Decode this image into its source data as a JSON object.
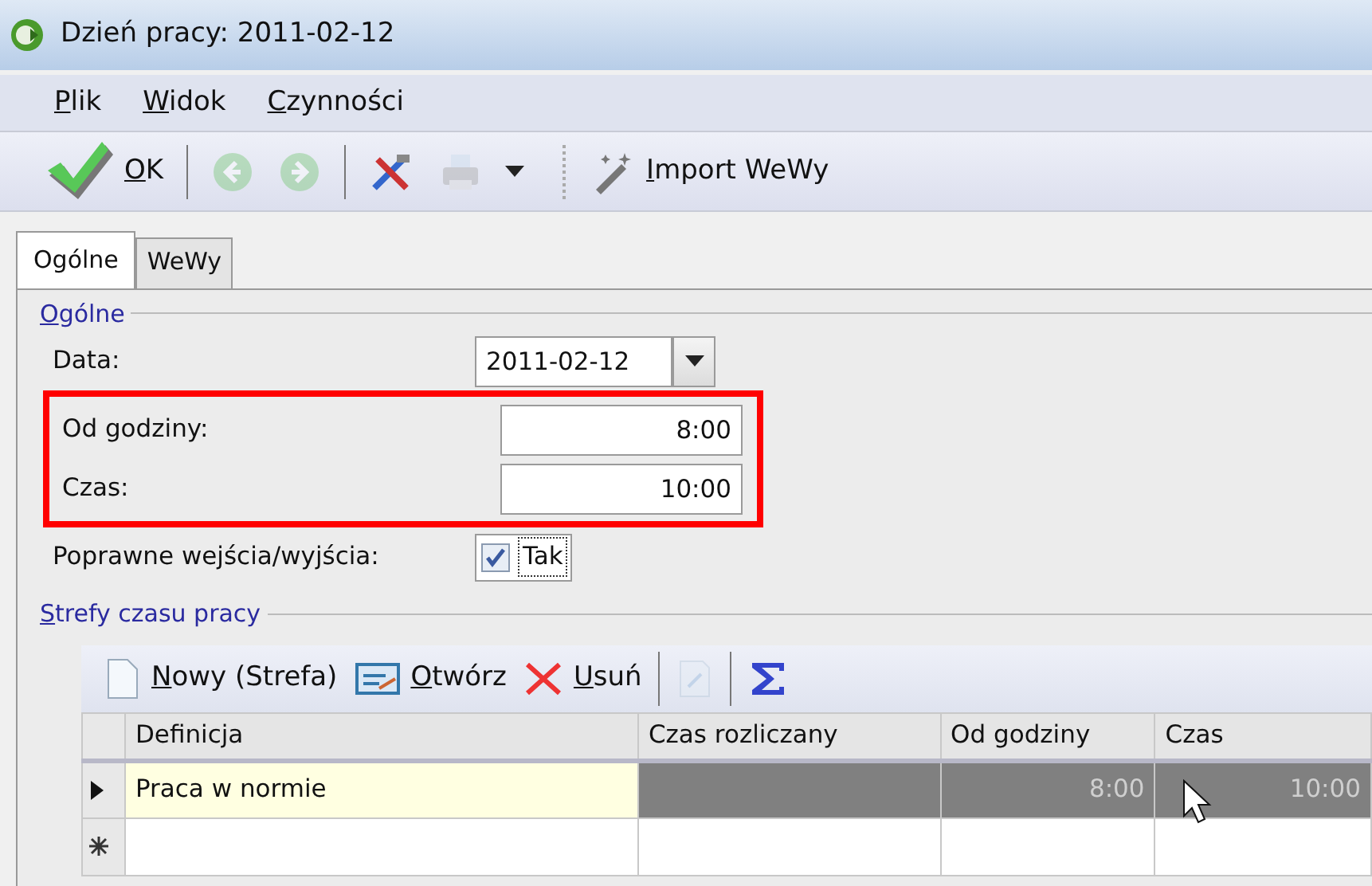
{
  "window": {
    "title": "Dzień pracy: 2011-02-12"
  },
  "menu": [
    {
      "label": "Plik"
    },
    {
      "label": "Widok"
    },
    {
      "label": "Czynności"
    }
  ],
  "toolbar": [
    {
      "kind": "ok",
      "label": "OK",
      "disabled": false
    },
    {
      "kind": "sep"
    },
    {
      "kind": "back",
      "disabled": true
    },
    {
      "kind": "forward",
      "disabled": true
    },
    {
      "kind": "sep"
    },
    {
      "kind": "tools",
      "disabled": false
    },
    {
      "kind": "print",
      "disabled": true
    },
    {
      "kind": "dropdown",
      "disabled": false
    },
    {
      "kind": "grip"
    },
    {
      "kind": "import",
      "label": "Import WeWy",
      "disabled": false
    }
  ],
  "tabs": [
    {
      "label": "Ogólne",
      "selected": true
    },
    {
      "label": "WeWy",
      "selected": false
    }
  ],
  "general": {
    "title": "Ogólne",
    "fields": [
      {
        "kind": "date",
        "label": "Data:",
        "value": "2011-02-12",
        "highlighted": false
      },
      {
        "kind": "text",
        "label": "Od godziny:",
        "value": "8:00",
        "highlighted": true
      },
      {
        "kind": "text",
        "label": "Czas:",
        "value": "10:00",
        "highlighted": true
      },
      {
        "kind": "check",
        "label": "Poprawne wejścia/wyjścia:",
        "value": "Tak",
        "checked": true,
        "highlighted": false
      }
    ]
  },
  "zones": {
    "title": "Strefy czasu pracy",
    "toolbar": [
      {
        "kind": "new",
        "label": "Nowy (Strefa)",
        "disabled": false
      },
      {
        "kind": "open",
        "label": "Otwórz",
        "disabled": false
      },
      {
        "kind": "delete",
        "label": "Usuń",
        "disabled": false
      },
      {
        "kind": "sep"
      },
      {
        "kind": "edit",
        "disabled": true
      },
      {
        "kind": "sep"
      },
      {
        "kind": "sum",
        "disabled": false
      }
    ],
    "columns": [
      "Definicja",
      "Czas rozliczany",
      "Od godziny",
      "Czas"
    ],
    "rows": [
      {
        "kind": "data",
        "selected": true,
        "cells": [
          "Praca w normie",
          "",
          "8:00",
          "10:00"
        ]
      },
      {
        "kind": "new",
        "selected": false,
        "cells": [
          "",
          "",
          "",
          ""
        ]
      }
    ]
  }
}
